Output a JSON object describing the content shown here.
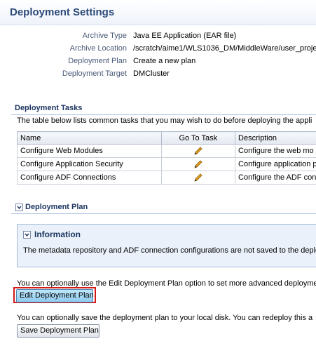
{
  "page": {
    "title": "Deployment Settings"
  },
  "summary": {
    "rows": [
      {
        "label": "Archive Type",
        "value": "Java EE Application (EAR file)"
      },
      {
        "label": "Archive Location",
        "value": "/scratch/aime1/WLS1036_DM/MiddleWare/user_proje"
      },
      {
        "label": "Deployment Plan",
        "value": "Create a new plan"
      },
      {
        "label": "Deployment Target",
        "value": "DMCluster"
      }
    ]
  },
  "tasks": {
    "header": "Deployment Tasks",
    "description": "The table below lists common tasks that you may wish to do before deploying the appli",
    "columns": [
      "Name",
      "Go To Task",
      "Description"
    ],
    "rows": [
      {
        "name": "Configure Web Modules",
        "go_icon": "pencil-icon",
        "description": "Configure the web mo"
      },
      {
        "name": "Configure Application Security",
        "go_icon": "pencil-icon",
        "description": "Configure application p"
      },
      {
        "name": "Configure ADF Connections",
        "go_icon": "pencil-icon",
        "description": "Configure the ADF con"
      }
    ]
  },
  "plan": {
    "header": "Deployment Plan",
    "info": {
      "title": "Information",
      "message": "The metadata repository and ADF connection configurations are not saved to the deplo"
    },
    "edit_text": "You can optionally use the Edit Deployment Plan option to set more advanced deployme",
    "edit_button": "Edit Deployment Plan",
    "save_text": "You can optionally save the deployment plan to your local disk. You can redeploy this a",
    "save_button": "Save Deployment Plan"
  },
  "colors": {
    "title": "#2c4a78",
    "section_header": "#1c3560",
    "highlight_frame": "#d21a1a",
    "info_background": "#eaf1fa"
  }
}
